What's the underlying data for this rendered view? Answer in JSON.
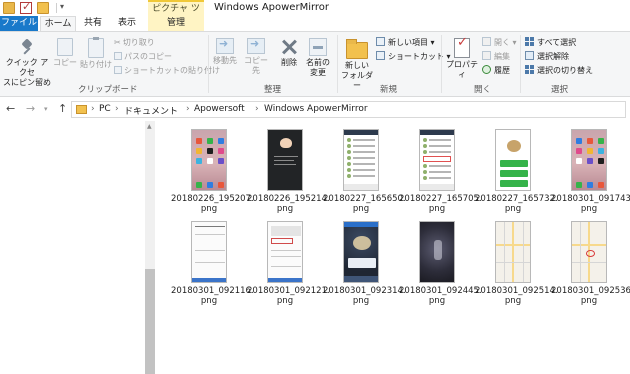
{
  "window": {
    "title": "Windows ApowerMirror",
    "contextual_tools_tab": "ピクチャ ツール"
  },
  "tabs": {
    "file": "ファイル",
    "home": "ホーム",
    "share": "共有",
    "view": "表示",
    "manage": "管理"
  },
  "ribbon": {
    "clipboard": {
      "group_label": "クリップボード",
      "pin_quick_access_line1": "クイック アクセ",
      "pin_quick_access_line2": "スにピン留め",
      "copy": "コピー",
      "paste": "貼り付け",
      "cut": "切り取り",
      "copy_path": "パスのコピー",
      "paste_shortcut": "ショートカットの貼り付け"
    },
    "organize": {
      "group_label": "整理",
      "move_to": "移動先",
      "copy_to": "コピー先",
      "delete": "削除",
      "rename_line1": "名前の",
      "rename_line2": "変更"
    },
    "new": {
      "group_label": "新規",
      "new_folder_line1": "新しい",
      "new_folder_line2": "フォルダー",
      "new_item": "新しい項目 ▾",
      "shortcut": "ショートカット ▾"
    },
    "open": {
      "group_label": "開く",
      "properties": "プロパティ",
      "open": "開く ▾",
      "edit": "編集",
      "history": "履歴"
    },
    "select": {
      "group_label": "選択",
      "select_all": "すべて選択",
      "select_none": "選択解除",
      "invert_selection": "選択の切り替え"
    }
  },
  "address_bar": {
    "breadcrumbs": [
      "PC",
      "ドキュメント",
      "Apowersoft",
      "Windows ApowerMirror"
    ]
  },
  "files": [
    {
      "name_line1": "20180226_195207.",
      "name_line2": "png",
      "thumb": "home"
    },
    {
      "name_line1": "20180226_195214.",
      "name_line2": "png",
      "thumb": "dark"
    },
    {
      "name_line1": "20180227_165650.",
      "name_line2": "png",
      "thumb": "chat"
    },
    {
      "name_line1": "20180227_165705.",
      "name_line2": "png",
      "thumb": "chat"
    },
    {
      "name_line1": "20180227_165732.",
      "name_line2": "png",
      "thumb": "green"
    },
    {
      "name_line1": "20180301_091743.",
      "name_line2": "png",
      "thumb": "home"
    },
    {
      "name_line1": "20180301_092116.",
      "name_line2": "png",
      "thumb": "doc"
    },
    {
      "name_line1": "20180301_092121.",
      "name_line2": "png",
      "thumb": "doc"
    },
    {
      "name_line1": "20180301_092314.",
      "name_line2": "png",
      "thumb": "lock"
    },
    {
      "name_line1": "20180301_092445.",
      "name_line2": "png",
      "thumb": "blur"
    },
    {
      "name_line1": "20180301_092514.",
      "name_line2": "png",
      "thumb": "map"
    },
    {
      "name_line1": "20180301_092536.",
      "name_line2": "png",
      "thumb": "map"
    }
  ],
  "colors": {
    "file_tab": "#1979ca",
    "tools_tab": "#fff4c4",
    "ribbon_bg": "#f5f6f7",
    "folder": "#f2c14e"
  },
  "icons": {
    "pin": "pin-icon",
    "copy": "copy-icon",
    "paste": "paste-icon",
    "delete": "delete-icon",
    "new_folder": "new-folder-icon",
    "properties": "properties-icon"
  }
}
